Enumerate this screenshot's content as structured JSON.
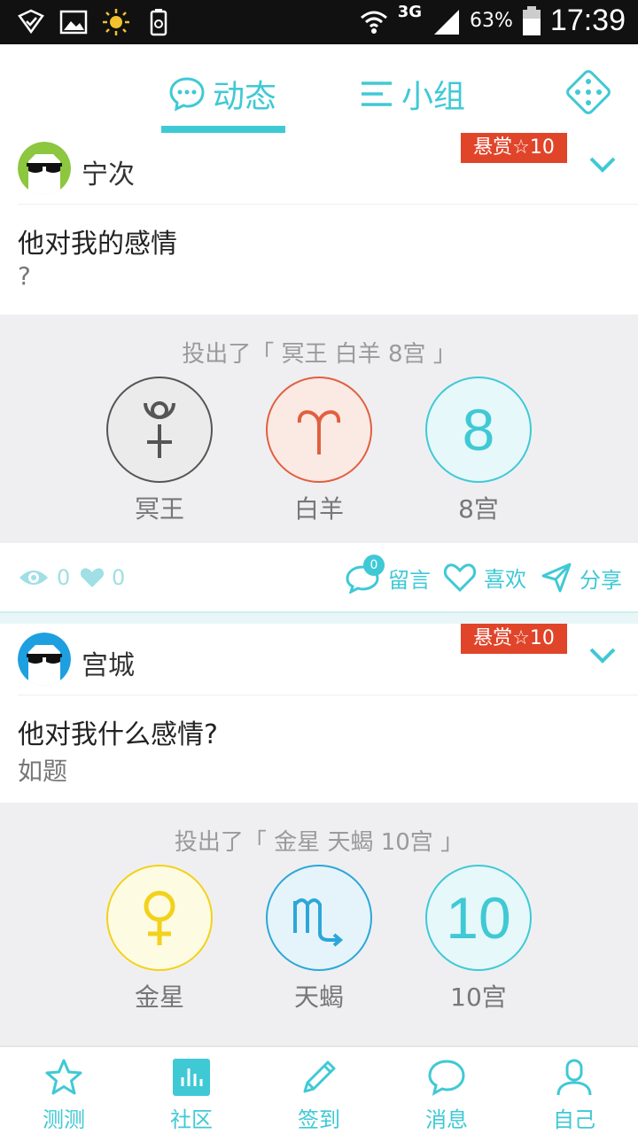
{
  "status_bar": {
    "network": "3G",
    "battery": "63%",
    "time": "17:39"
  },
  "top_nav": {
    "tabs": [
      {
        "label": "动态",
        "active": true,
        "icon": "chat-bubble-icon"
      },
      {
        "label": "小组",
        "active": false,
        "icon": "list-icon"
      }
    ],
    "dice_icon": "dice-icon"
  },
  "posts": [
    {
      "username": "宁次",
      "avatar_color": "#8dc63f",
      "bounty": "悬赏☆10",
      "title": "他对我的感情",
      "body": "?",
      "cast_label": "投出了「 冥王 白羊 8宫 」",
      "dice": [
        {
          "caption": "冥王",
          "symbol": "pluto-icon",
          "color": "#555555",
          "fill": "#ebebeb"
        },
        {
          "caption": "白羊",
          "symbol": "aries-icon",
          "color": "#e0603f",
          "fill": "#fbe9e4"
        },
        {
          "caption": "8宫",
          "value": "8",
          "color": "#3fc9d5",
          "fill": "#e6f8fa"
        }
      ],
      "views": "0",
      "likes": "0",
      "comment_count": "0",
      "actions": {
        "comment": "留言",
        "like": "喜欢",
        "share": "分享"
      }
    },
    {
      "username": "宫城",
      "avatar_color": "#1e9fe0",
      "bounty": "悬赏☆10",
      "title": "他对我什么感情?",
      "body": "如题",
      "cast_label": "投出了「 金星 天蝎 10宫 」",
      "dice": [
        {
          "caption": "金星",
          "symbol": "venus-icon",
          "color": "#f2d21a",
          "fill": "#fefbe3"
        },
        {
          "caption": "天蝎",
          "symbol": "scorpio-icon",
          "color": "#2ca7d8",
          "fill": "#e5f4fb"
        },
        {
          "caption": "10宫",
          "value": "10",
          "color": "#3fc9d5",
          "fill": "#e6f8fa"
        }
      ]
    }
  ],
  "bottom_nav": [
    {
      "label": "测测",
      "icon": "star-icon"
    },
    {
      "label": "社区",
      "icon": "chart-icon",
      "active": true
    },
    {
      "label": "签到",
      "icon": "pencil-icon"
    },
    {
      "label": "消息",
      "icon": "chat-bubble-icon"
    },
    {
      "label": "自己",
      "icon": "person-icon"
    }
  ],
  "colors": {
    "accent": "#3fc9d5",
    "bounty": "#e0452a"
  }
}
